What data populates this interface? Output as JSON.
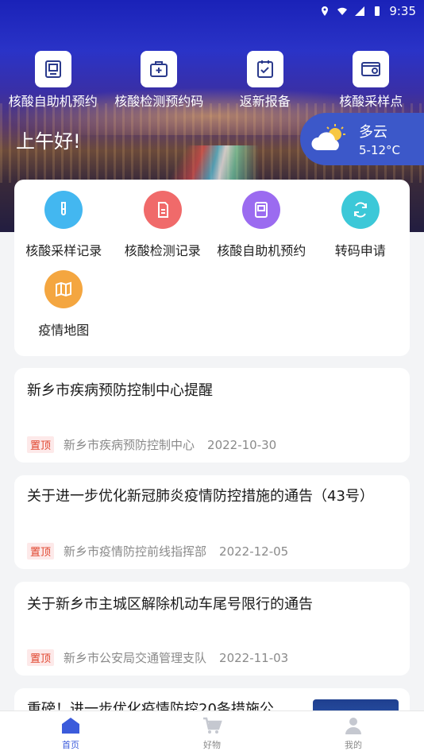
{
  "status_bar": {
    "time": "9:35"
  },
  "top_shortcuts": [
    {
      "label": "核酸自助机预约",
      "icon": "kiosk-icon"
    },
    {
      "label": "核酸检测预约码",
      "icon": "medical-kit-icon"
    },
    {
      "label": "返新报备",
      "icon": "clipboard-check-icon"
    },
    {
      "label": "核酸采样点",
      "icon": "location-card-icon"
    }
  ],
  "greeting": "上午好!",
  "weather": {
    "condition": "多云",
    "temp": "5-12°C",
    "icon": "cloud-sun-icon"
  },
  "services": [
    {
      "label": "核酸采样记录",
      "icon": "test-tube-icon",
      "color": "#43b7f0"
    },
    {
      "label": "核酸检测记录",
      "icon": "document-icon",
      "color": "#f06a6a"
    },
    {
      "label": "核酸自助机预约",
      "icon": "kiosk-icon",
      "color": "#9b6bf0"
    },
    {
      "label": "转码申请",
      "icon": "refresh-icon",
      "color": "#3cc8d8"
    },
    {
      "label": "疫情地图",
      "icon": "map-icon",
      "color": "#f4a640"
    }
  ],
  "news": [
    {
      "title": "新乡市疾病预防控制中心提醒",
      "tag": "置顶",
      "source": "新乡市疾病预防控制中心",
      "date": "2022-10-30"
    },
    {
      "title": "关于进一步优化新冠肺炎疫情防控措施的通告（43号）",
      "tag": "置顶",
      "source": "新乡市疫情防控前线指挥部",
      "date": "2022-12-05"
    },
    {
      "title": "关于新乡市主城区解除机动车尾号限行的通告",
      "tag": "置顶",
      "source": "新乡市公安局交通管理支队",
      "date": "2022-11-03"
    },
    {
      "title": "重磅！进一步优化疫情防控20条措施公"
    }
  ],
  "tabbar": [
    {
      "label": "首页",
      "icon": "home-icon",
      "active": true
    },
    {
      "label": "好物",
      "icon": "shopping-cart-icon",
      "active": false
    },
    {
      "label": "我的",
      "icon": "user-icon",
      "active": false
    }
  ],
  "colors": {
    "accent": "#3b5bdb",
    "tag_bg": "#fde9e9",
    "tag_text": "#e0452e"
  }
}
